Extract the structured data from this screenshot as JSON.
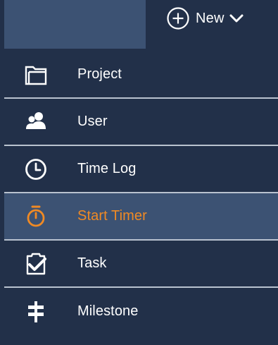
{
  "header": {
    "new_label": "New",
    "new_icon": "plus-circle-icon",
    "dropdown_icon": "chevron-down-icon"
  },
  "menu": {
    "items": [
      {
        "label": "Project",
        "icon": "folder-icon",
        "active": false
      },
      {
        "label": "User",
        "icon": "users-icon",
        "active": false
      },
      {
        "label": "Time Log",
        "icon": "clock-icon",
        "active": false
      },
      {
        "label": "Start Timer",
        "icon": "stopwatch-icon",
        "active": true
      },
      {
        "label": "Task",
        "icon": "clipboard-check-icon",
        "active": false
      },
      {
        "label": "Milestone",
        "icon": "signpost-icon",
        "active": false
      }
    ]
  },
  "colors": {
    "background": "#223049",
    "highlight": "#3c5273",
    "active_text": "#f08a24",
    "text": "#ffffff",
    "divider": "#b9c2cf"
  }
}
